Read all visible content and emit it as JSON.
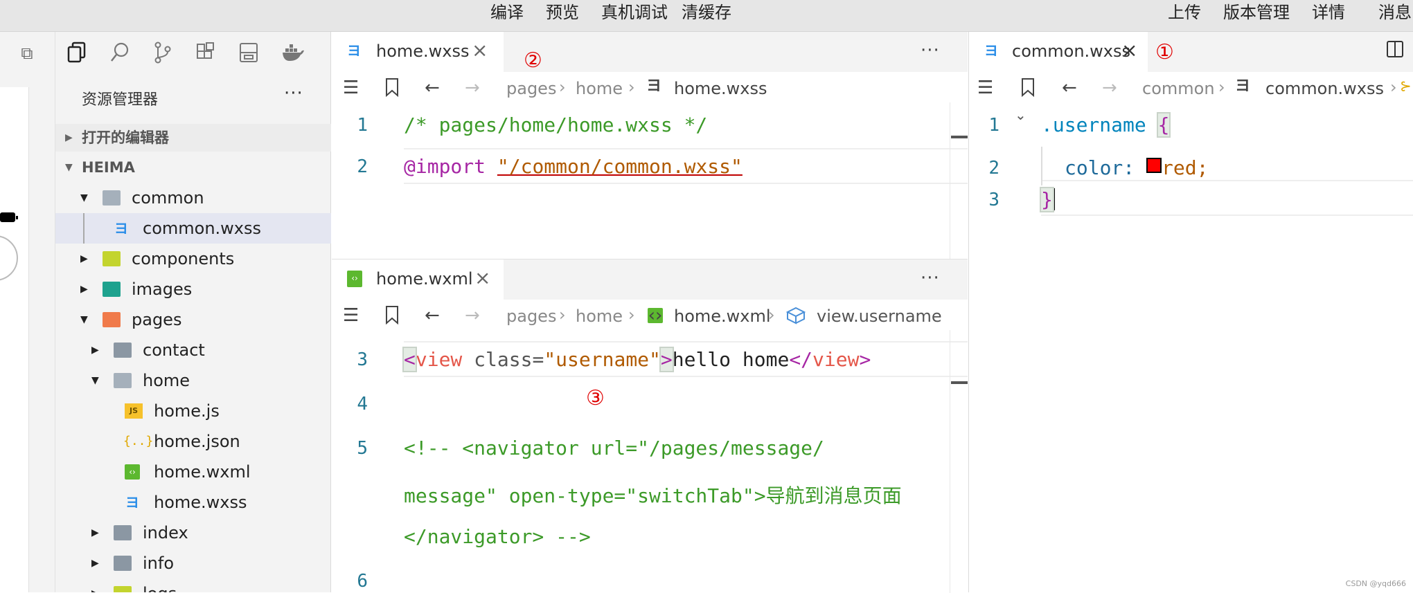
{
  "toolbar": {
    "compile": "编译",
    "preview": "预览",
    "device_debug": "真机调试",
    "clear_cache": "清缓存",
    "upload": "上传",
    "version_mgmt": "版本管理",
    "details": "详情",
    "messages": "消息"
  },
  "explorer": {
    "title": "资源管理器",
    "more": "···",
    "open_editors": "打开的编辑器",
    "project": "HEIMA",
    "tree": [
      {
        "label": "common"
      },
      {
        "label": "common.wxss"
      },
      {
        "label": "components"
      },
      {
        "label": "images"
      },
      {
        "label": "pages"
      },
      {
        "label": "contact"
      },
      {
        "label": "home"
      },
      {
        "label": "home.js"
      },
      {
        "label": "home.json"
      },
      {
        "label": "home.wxml"
      },
      {
        "label": "home.wxss"
      },
      {
        "label": "index"
      },
      {
        "label": "info"
      },
      {
        "label": "logs"
      }
    ]
  },
  "editor_top": {
    "tab": "home.wxss",
    "more": "···",
    "crumbs": [
      "pages",
      "home",
      "home.wxss"
    ],
    "lines": [
      {
        "n": "1",
        "comment": "/* pages/home/home.wxss */"
      },
      {
        "n": "2",
        "at": "@import",
        "str": "\"/common/common.wxss\""
      }
    ]
  },
  "editor_bottom": {
    "tab": "home.wxml",
    "more": "···",
    "crumbs": [
      "pages",
      "home",
      "home.wxml",
      "view.username"
    ],
    "lines": [
      {
        "n": "3",
        "open_bracket": "<",
        "tag": "view",
        "attr": "class=",
        "val": "\"username\"",
        "close_bracket": ">",
        "text": "hello home",
        "end_open": "</",
        "end_tag": "view",
        "end_close": ">"
      },
      {
        "n": "4"
      },
      {
        "n": "5",
        "c1": "<!-- <navigator url=\"/pages/message/",
        "c2": "message\" open-type=\"switchTab\">导航到消息页面",
        "c3": "</navigator> -->"
      },
      {
        "n": "6"
      }
    ]
  },
  "editor_right": {
    "tab": "common.wxss",
    "crumbs": [
      "common",
      "common.wxss"
    ],
    "lines": [
      {
        "n": "1",
        "selector": ".username",
        "brace": "{"
      },
      {
        "n": "2",
        "prop": "color:",
        "value": "red;"
      },
      {
        "n": "3",
        "brace": "}"
      }
    ],
    "swatch_color": "#ff0000"
  },
  "annotations": {
    "a1": "①",
    "a2": "②",
    "a3": "③"
  },
  "watermark": "CSDN @yqd666"
}
